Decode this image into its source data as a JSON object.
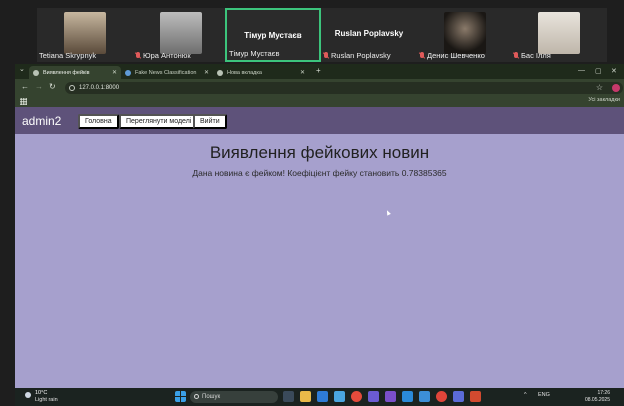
{
  "call": {
    "participants": [
      {
        "name": "Tetiana Skrypnyk",
        "muted": false,
        "color": "#7a6a58"
      },
      {
        "name": "Юра Антонюк",
        "muted": true,
        "color": "#8f8f8f"
      },
      {
        "name": "Тімур Мустаєв",
        "muted": false,
        "active": true,
        "big_name": "Тімур Мустаєв"
      },
      {
        "name": "Ruslan Poplavsky",
        "muted": true,
        "big_name": "Ruslan Poplavsky"
      },
      {
        "name": "Денис Шевченко",
        "muted": true,
        "color": "#3b3530"
      },
      {
        "name": "Бас Ілля",
        "muted": true,
        "color": "#d4d0c8"
      }
    ]
  },
  "browser": {
    "tabs": [
      {
        "title": "Виявлення фейків",
        "active": true
      },
      {
        "title": "Fake News Classification",
        "active": false
      },
      {
        "title": "Нова вкладка",
        "active": false
      }
    ],
    "new_tab": "+",
    "url": "127.0.0.1:8000",
    "bookmarks_label": "Усі закладки",
    "window_controls": {
      "minimize": "—",
      "maximize": "▢",
      "close": "✕"
    },
    "nav": {
      "back": "←",
      "forward": "→",
      "reload": "↻",
      "star": "☆",
      "tabs_menu": "⌄"
    }
  },
  "page": {
    "brand": "admin2",
    "buttons": {
      "home": "Головна",
      "models": "Переглянути моделі",
      "logout": "Вийти"
    },
    "title": "Виявлення фейкових новин",
    "result": "Дана новина є фейком! Коефіцієнт фейку становить 0.78385365"
  },
  "taskbar": {
    "weather_temp": "10°C",
    "weather_desc": "Light rain",
    "search_placeholder": "Пошук",
    "tray_lang": "ENG",
    "time": "17:26",
    "date": "08.05.2025",
    "tray_chevron": "^"
  },
  "colors": {
    "page_bg": "#a6a0cd",
    "navbar_bg": "#5e527a",
    "browser_frame": "#35432f",
    "active_speaker_border": "#3cc47c"
  }
}
